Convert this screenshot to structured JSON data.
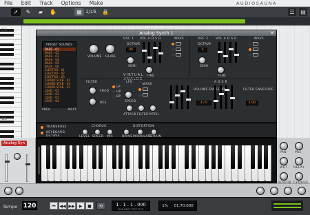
{
  "menu": [
    "File",
    "Edit",
    "Track",
    "Options",
    "Make"
  ],
  "brand": "AUDIOSAUNA",
  "toolbar": {
    "grid": "1/16",
    "tools": [
      "pointer-icon",
      "pencil-icon",
      "eraser-icon",
      "hand-icon"
    ],
    "progress": 0.87
  },
  "roll_labels": [
    "C6",
    "C5"
  ],
  "synth": {
    "title": "Analog Synth 1",
    "preset_header": "PRESET SOUNDS",
    "presets": [
      "BASS - 01",
      "BASS - 02",
      "BASS - 03",
      "BASS - 04",
      "BASS - 05",
      "BASS - 06",
      "ELECTRO - 01",
      "ELECTRO - 02",
      "ELECTRO - 03",
      "CHORD STAB - 01",
      "CHORD STAB - 02",
      "CHORD STAB - 03",
      "LEAD - 01",
      "LEAD - 02",
      "LEAD - 03",
      "LEAD - 04"
    ],
    "selected_preset": 0,
    "prev": "PREV",
    "next": "NEXT",
    "volume": "VOLUME",
    "glide": "GLIDE",
    "brand1": "VIRTUAL",
    "brand2": "ANALOG",
    "osc1": "OSC 1",
    "osc2": "OSC 2",
    "octave": "OCTAVE",
    "semi": "SEMI",
    "fine": "FINE",
    "wave": "WAVE",
    "vol_adsr": "VOL  A  D  S  R",
    "filter": "FILTER",
    "freq": "FREQ",
    "res": "RES",
    "filter_modes": [
      "LP",
      "HP",
      "BP"
    ],
    "lfo": "LFO",
    "speed": "SPEED",
    "attack": "ATTACK",
    "filter_lbl": "FILTER",
    "pitch": "PITCH",
    "volume_env": "VOLUME ENVELOPE",
    "filter_env": "FILTER ENVELOPE",
    "env_labels": "A  D  S  R",
    "osc_display_1": "00",
    "osc_display_2": "0",
    "osc_display_3": "01",
    "osc_display_4": "02",
    "env_display_1": "4 / 0",
    "env_display_2": "1.00"
  },
  "fx": {
    "transpose": "TRANSPOSE",
    "keyboard_octave": "KEYBOARD\nOCTAVE",
    "chorus": "CHORUS",
    "chorus_knobs": [
      "LEVEL",
      "SPEED",
      "MIX"
    ],
    "distortion": "DISTORTION",
    "dist_knobs": [
      "DRIVE",
      "MODULATE",
      "STRAIN"
    ]
  },
  "track": {
    "name": "Analog Syn"
  },
  "mixer": {
    "labels": [
      "PAN",
      "PRE",
      "WET",
      "DELAY",
      "REVERB",
      "CHORUS"
    ]
  },
  "transport": {
    "tempo_label": "Tempo",
    "tempo": "120",
    "position": "1 . 1 . 1 . 000",
    "position_sub": "BAR  BEAT  STEP  TICK",
    "meter_a": "1%",
    "meter_b": "01:70:000"
  }
}
